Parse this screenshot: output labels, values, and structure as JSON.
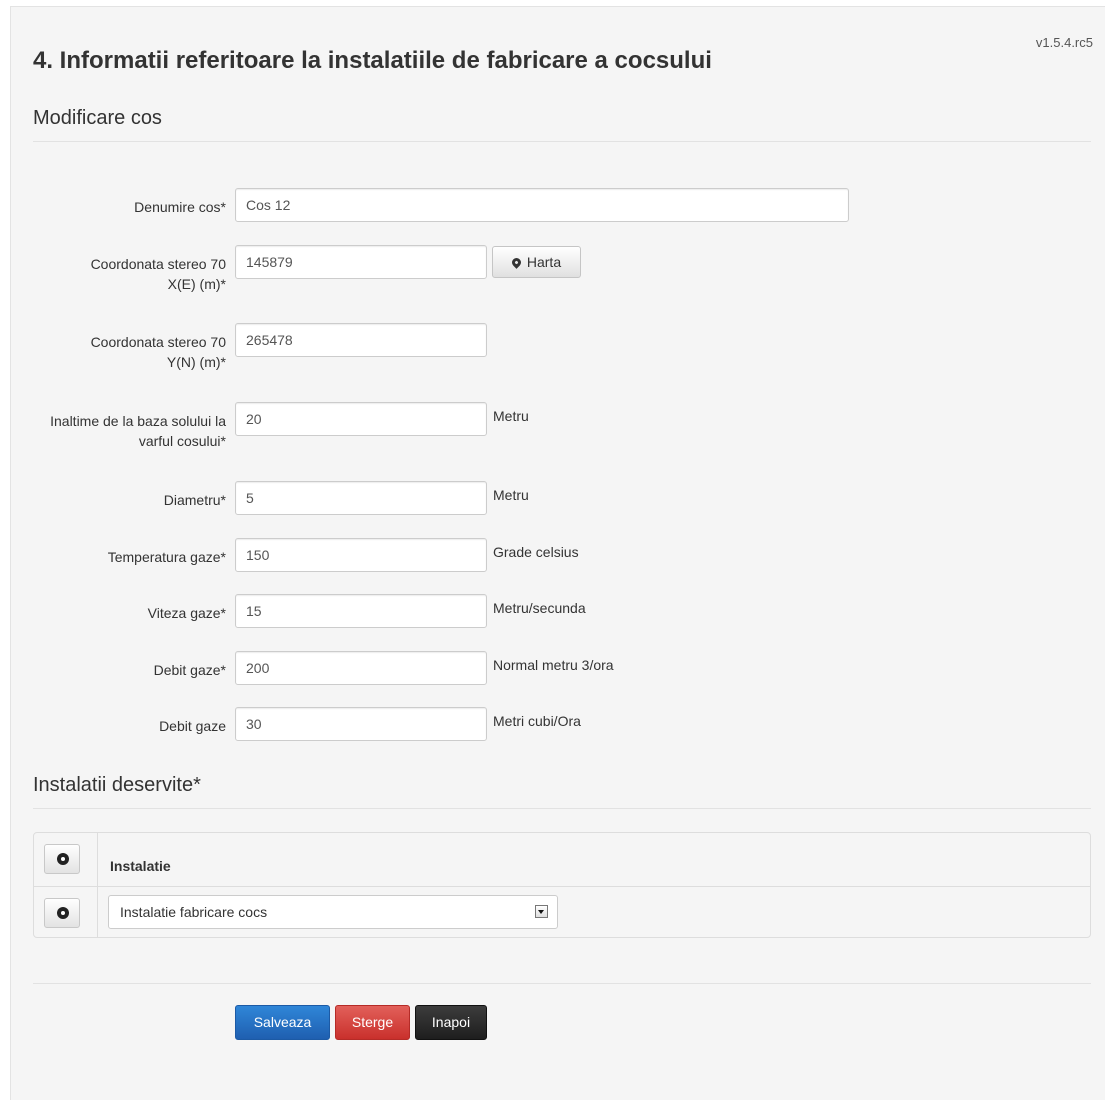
{
  "version": "v1.5.4.rc5",
  "title": "4. Informatii referitoare la instalatiile de fabricare a cocsului",
  "section_main": "Modificare cos",
  "fields": [
    {
      "label": "Denumire cos*",
      "value": "Cos 12",
      "unit": ""
    },
    {
      "label": "Coordonata stereo 70 X(E) (m)*",
      "value": "145879",
      "unit": ""
    },
    {
      "label": "Coordonata stereo 70 Y(N) (m)*",
      "value": "265478",
      "unit": ""
    },
    {
      "label": "Inaltime de la baza solului la varful cosului*",
      "value": "20",
      "unit": "Metru"
    },
    {
      "label": "Diametru*",
      "value": "5",
      "unit": "Metru"
    },
    {
      "label": "Temperatura gaze*",
      "value": "150",
      "unit": "Grade celsius"
    },
    {
      "label": "Viteza gaze*",
      "value": "15",
      "unit": "Metru/secunda"
    },
    {
      "label": "Debit gaze*",
      "value": "200",
      "unit": "Normal metru 3/ora"
    },
    {
      "label": "Debit gaze",
      "value": "30",
      "unit": "Metri cubi/Ora"
    }
  ],
  "map_button": {
    "label": "Harta",
    "icon": "map-marker-icon"
  },
  "section_installations": "Instalatii deservite*",
  "installations_table": {
    "header": "Instalatie",
    "rows": [
      {
        "value": "Instalatie fabricare cocs"
      }
    ]
  },
  "actions": {
    "save": "Salveaza",
    "delete": "Sterge",
    "back": "Inapoi"
  }
}
